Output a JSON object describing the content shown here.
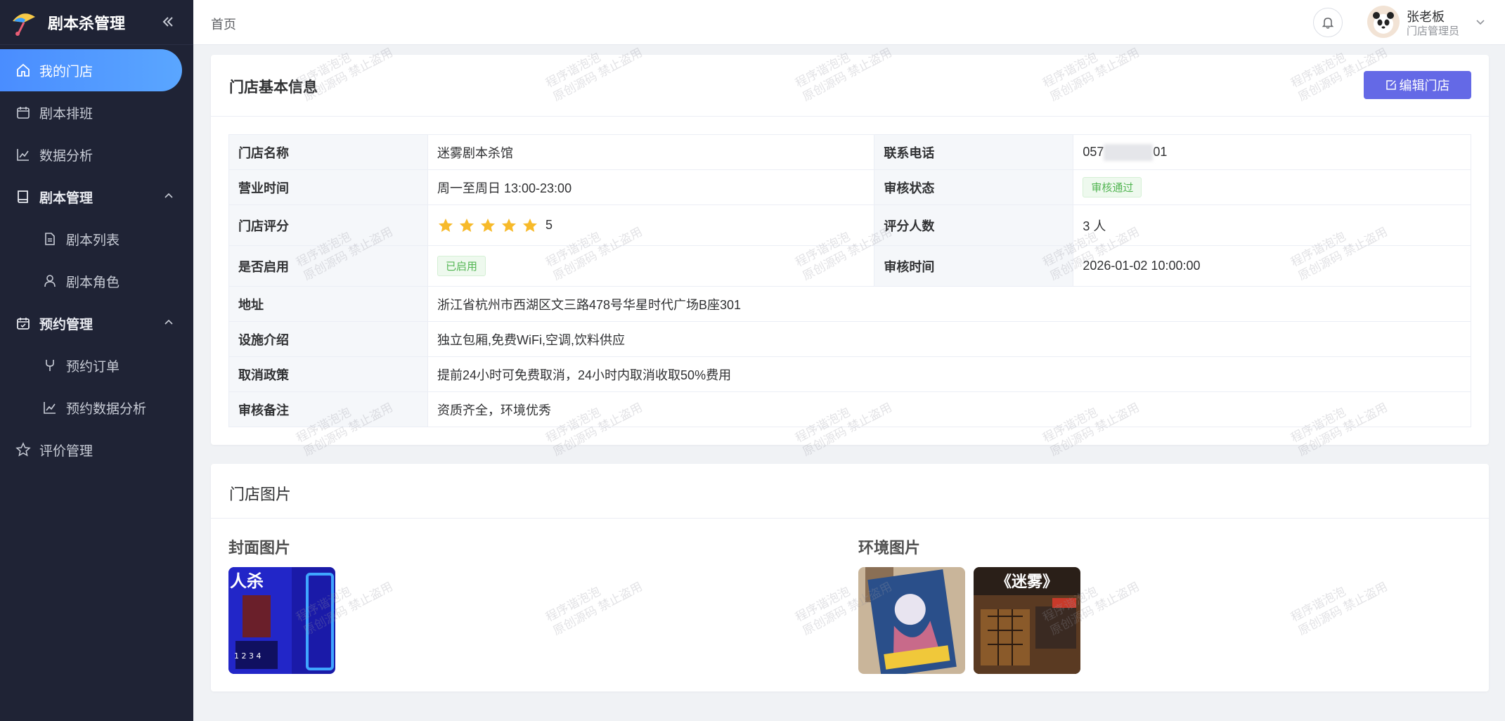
{
  "app": {
    "title": "剧本杀管理"
  },
  "sidebar": {
    "items": [
      {
        "label": "我的门店",
        "icon": "home-icon",
        "active": true
      },
      {
        "label": "剧本排班",
        "icon": "calendar-icon"
      },
      {
        "label": "数据分析",
        "icon": "line-chart-icon"
      },
      {
        "label": "剧本管理",
        "icon": "book-icon",
        "group": true
      },
      {
        "label": "剧本列表",
        "icon": "document-icon"
      },
      {
        "label": "剧本角色",
        "icon": "user-icon"
      },
      {
        "label": "预约管理",
        "icon": "calendar-check-icon",
        "group": true
      },
      {
        "label": "预约订单",
        "icon": "branch-icon"
      },
      {
        "label": "预约数据分析",
        "icon": "line-chart-icon"
      },
      {
        "label": "评价管理",
        "icon": "star-outline-icon"
      }
    ]
  },
  "header": {
    "breadcrumb": "首页",
    "user_name": "张老板",
    "user_role": "门店管理员"
  },
  "store_info": {
    "title": "门店基本信息",
    "edit_label": "编辑门店",
    "rows": {
      "name_label": "门店名称",
      "name": "迷雾剧本杀馆",
      "phone_label": "联系电话",
      "phone_prefix": "057",
      "phone_suffix": "01",
      "hours_label": "营业时间",
      "hours": "周一至周日 13:00-23:00",
      "audit_status_label": "审核状态",
      "audit_status": "审核通过",
      "rating_label": "门店评分",
      "rating": 5,
      "rating_count_label": "评分人数",
      "rating_count": "3 人",
      "enabled_label": "是否启用",
      "enabled": "已启用",
      "audit_time_label": "审核时间",
      "audit_time": "2026-01-02 10:00:00",
      "address_label": "地址",
      "address": "浙江省杭州市西湖区文三路478号华星时代广场B座301",
      "facilities_label": "设施介绍",
      "facilities": "独立包厢,免费WiFi,空调,饮料供应",
      "cancel_label": "取消政策",
      "cancel": "提前24小时可免费取消，24小时内取消收取50%费用",
      "audit_note_label": "审核备注",
      "audit_note": "资质齐全，环境优秀"
    }
  },
  "store_images": {
    "title": "门店图片",
    "cover_label": "封面图片",
    "env_label": "环境图片",
    "cover_text": "人杀",
    "env2_text": "《迷雾》"
  },
  "watermark": {
    "line1": "程序谐泡泡",
    "line2": "原创源码 禁止盗用"
  },
  "colors": {
    "sidebar_bg": "#1f2335",
    "active": "#4a8dff",
    "primary_btn": "#6469e6",
    "star": "#f7ba2a",
    "success": "#52b552"
  }
}
